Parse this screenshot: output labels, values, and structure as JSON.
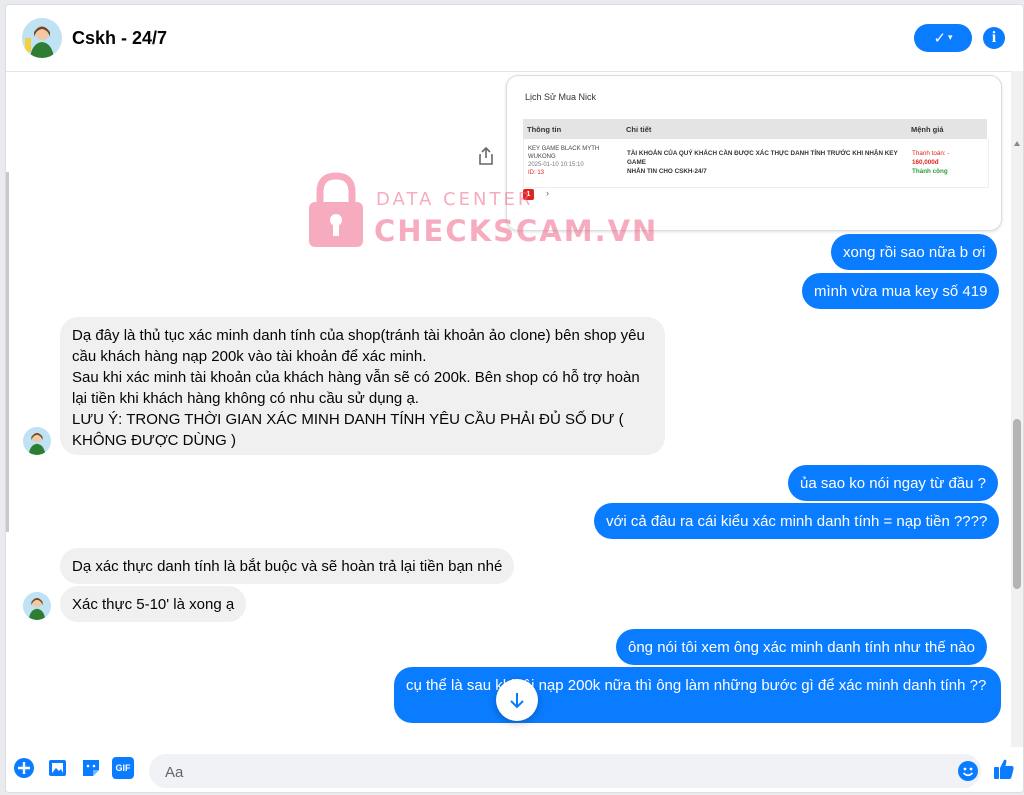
{
  "header": {
    "title": "Cskh - 24/7",
    "check_label": "✓",
    "check_caret": "▾",
    "info_label": "i",
    "accent": "#0a7cff"
  },
  "card": {
    "title": "Lịch Sử Mua Nick",
    "columns": [
      "Thông tin",
      "Chi tiết",
      "Mệnh giá"
    ],
    "row": {
      "product": "KEY GAME BLACK MYTH WUKONG",
      "datetime": "2025-01-10 10:15:10",
      "id": "ID: 13",
      "details": [
        "TÀI KHOẢN CỦA QUÝ KHÁCH CẦN ĐƯỢC XÁC THỰC DANH TÍNH TRƯỚC KHI NHẬN KEY GAME",
        "NHẮN TIN CHO CSKH-24/7"
      ],
      "price_label": "Thanh toán: -",
      "amount": "160,000đ",
      "status": "Thành công"
    },
    "pager_current": "1",
    "pager_next": "›"
  },
  "watermark": {
    "line1": "DATA CENTER",
    "line2": "CHECKSCAM.VN"
  },
  "messages": {
    "out_1": "xong rồi sao nữa b ơi",
    "out_2": "mình vừa mua key số 419",
    "in_1": [
      "Dạ đây là thủ tục xác minh danh tính của shop(tránh tài khoản ảo clone) bên shop yêu cầu khách hàng nạp 200k vào tài khoản để xác minh.",
      "Sau khi xác minh tài khoản của khách hàng vẫn sẽ có 200k. Bên shop có hỗ trợ hoàn lại tiền khi khách hàng không có nhu cầu sử dụng ạ.",
      "LƯU Ý: TRONG THỜI GIAN XÁC MINH DANH TÍNH YÊU CẦU PHẢI ĐỦ SỐ DƯ ( KHÔNG ĐƯỢC DÙNG )"
    ],
    "out_3": "ủa sao ko nói ngay từ đầu ?",
    "out_4": "với cả đâu ra cái kiểu xác minh danh tính = nạp tiền ????",
    "in_2": "Dạ xác thực danh tính là bắt buộc và sẽ hoàn trả lại tiền bạn nhé",
    "in_3": "Xác thực 5-10' là xong ạ",
    "out_5": "ông nói tôi xem ông xác minh danh tính như thế nào",
    "out_6": "cụ thể là sau khi tôi nạp 200k nữa thì ông làm những bước gì để xác minh danh tính ??"
  },
  "composer": {
    "placeholder": "Aa",
    "gif_label": "GIF"
  }
}
